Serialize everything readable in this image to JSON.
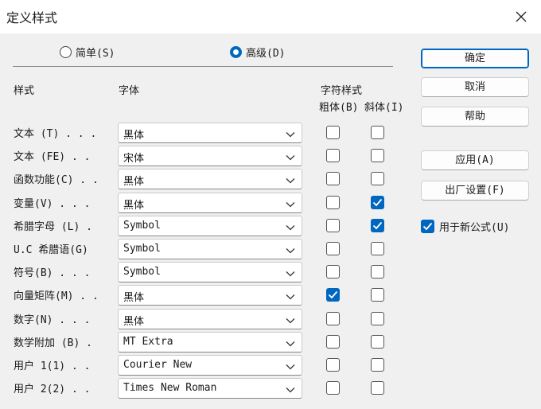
{
  "window": {
    "title": "定义样式"
  },
  "mode": {
    "simple_label": "简单(S)",
    "advanced_label": "高级(D)",
    "selected": "advanced"
  },
  "headers": {
    "style": "样式",
    "font": "字体",
    "char_style": "字符样式",
    "bold": "粗体(B)",
    "italic": "斜体(I)"
  },
  "rows": [
    {
      "label": "文本 (T) . . .",
      "font": "黑体",
      "bold": false,
      "italic": false
    },
    {
      "label": "文本 (FE) . .",
      "font": "宋体",
      "bold": false,
      "italic": false
    },
    {
      "label": "函数功能(C) . .",
      "font": "黑体",
      "bold": false,
      "italic": false
    },
    {
      "label": "变量(V) . . .",
      "font": "黑体",
      "bold": false,
      "italic": true
    },
    {
      "label": "希腊字母 (L) .",
      "font": "Symbol",
      "bold": false,
      "italic": true
    },
    {
      "label": "U.C 希腊语(G)",
      "font": "Symbol",
      "bold": false,
      "italic": false
    },
    {
      "label": "符号(B) . . .",
      "font": "Symbol",
      "bold": false,
      "italic": false
    },
    {
      "label": "向量矩阵(M) . .",
      "font": "黑体",
      "bold": true,
      "italic": false
    },
    {
      "label": "数字(N) . . .",
      "font": "黑体",
      "bold": false,
      "italic": false
    },
    {
      "label": "数学附加 (B) .",
      "font": "MT Extra",
      "bold": false,
      "italic": false
    },
    {
      "label": "用户 1(1) . .",
      "font": "Courier New",
      "bold": false,
      "italic": false
    },
    {
      "label": "用户 2(2) . .",
      "font": "Times New Roman",
      "bold": false,
      "italic": false
    }
  ],
  "buttons": {
    "ok": "确定",
    "cancel": "取消",
    "help": "帮助",
    "apply": "应用(A)",
    "factory": "出厂设置(F)"
  },
  "new_equations": {
    "label": "用于新公式(U)",
    "checked": true
  },
  "colors": {
    "accent": "#0067c0",
    "background": "#f0f0f0"
  }
}
